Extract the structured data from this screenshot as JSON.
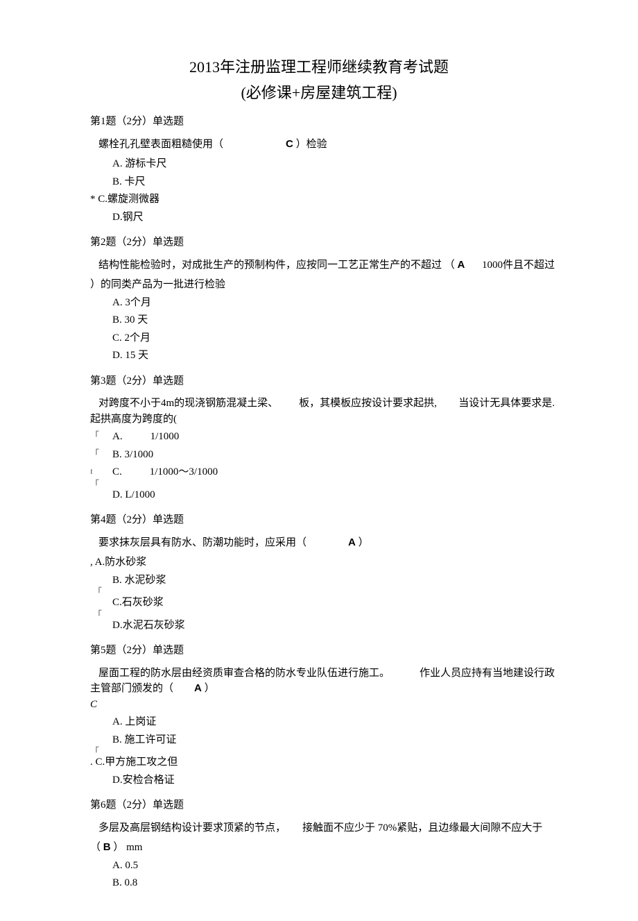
{
  "title": "2013年注册监理工程师继续教育考试题",
  "subtitle": "(必修课+房屋建筑工程)",
  "q1": {
    "header": "第1题（2分）单选题",
    "stem_a": "螺栓孔孔壁表面粗糙使用（",
    "stem_b": "）检验",
    "answer": "C",
    "optA": "A.  游标卡尺",
    "optB": "B.  卡尺",
    "optC": "* C.螺旋测微器",
    "optD": "D.钢尺"
  },
  "q2": {
    "header": "第2题（2分）单选题",
    "stem_a": "结构性能检验时，对成批生产的预制构件，应按同一工艺正常生产的不超过 （",
    "stem_b": "）的同类产品为一批进行检验",
    "answer": "A",
    "note": "1000件且不超过",
    "optA": "A.  3个月",
    "optB": "B.  30 天",
    "optC": "C.  2个月",
    "optD": "D.  15 天"
  },
  "q3": {
    "header": "第3题（2分）单选题",
    "stem_a": "对跨度不小于4m的现浇钢筋混凝土梁、",
    "stem_b": "板，其模板应按设计要求起拱,",
    "stem_c": "当设计无具体要求是.",
    "stem_d": "起拱高度为跨度的(",
    "optA_label": "A.",
    "optA_val": "1/1000",
    "optB": "B.  3/1000",
    "optC_label": "C.",
    "optC_val": "1/1000～3/1000",
    "optD": "D.  L/1000"
  },
  "q4": {
    "header": "第4题（2分）单选题",
    "stem_a": "要求抹灰层具有防水、防潮功能时，应采用（",
    "stem_b": "）",
    "answer": "A",
    "optA": ", A.防水砂浆",
    "optB": "B.    水泥砂浆",
    "optC": "C.石灰砂浆",
    "optD": "D.水泥石灰砂浆"
  },
  "q5": {
    "header": "第5题（2分）单选题",
    "stem_a": "屋面工程的防水层由经资质审查合格的防水专业队伍进行施工。",
    "stem_b": "作业人员应持有当地建设行政",
    "stem_c": "主管部门颁发的（",
    "stem_d": "）",
    "answer": "A",
    "float": "C",
    "optA": "A.  上岗证",
    "optB": "B.  施工许可证",
    "optC": ". C.甲方施工攻之但",
    "optD": "D.安检合格证"
  },
  "q6": {
    "header": "第6题（2分）单选题",
    "stem_a": "多层及高层钢结构设计要求顶紧的节点，",
    "stem_b": "接触面不应少于 70%紧贴，且边缘最大间隙不应大于",
    "stem_c": "（",
    "stem_d": "） mm",
    "answer": "B",
    "optA": "A.  0.5",
    "optB": "B.  0.8"
  }
}
